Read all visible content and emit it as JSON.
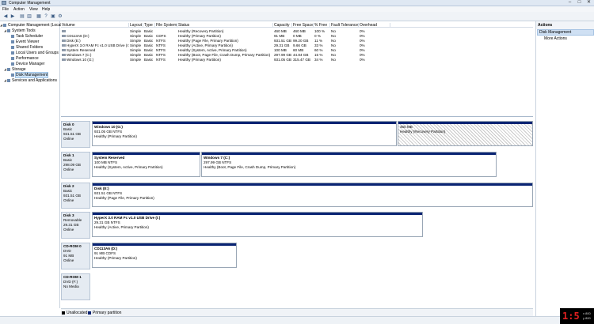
{
  "title": "Computer Management",
  "menu": [
    "File",
    "Action",
    "View",
    "Help"
  ],
  "tree": [
    {
      "label": "Computer Management (Local)",
      "indent": 0
    },
    {
      "label": "System Tools",
      "indent": 1
    },
    {
      "label": "Task Scheduler",
      "indent": 2
    },
    {
      "label": "Event Viewer",
      "indent": 2
    },
    {
      "label": "Shared Folders",
      "indent": 2
    },
    {
      "label": "Local Users and Groups",
      "indent": 2
    },
    {
      "label": "Performance",
      "indent": 2
    },
    {
      "label": "Device Manager",
      "indent": 2
    },
    {
      "label": "Storage",
      "indent": 1
    },
    {
      "label": "Disk Management",
      "indent": 2,
      "selected": true
    },
    {
      "label": "Services and Applications",
      "indent": 1
    }
  ],
  "columns": [
    "Volume",
    "Layout",
    "Type",
    "File System",
    "Status",
    "Capacity",
    "Free Space",
    "% Free",
    "Fault Tolerance",
    "Overhead"
  ],
  "volumes": [
    [
      "",
      "Simple",
      "Basic",
      "",
      "Healthy (Recovery Partition)",
      "460 MB",
      "460 MB",
      "100 %",
      "No",
      "0%"
    ],
    [
      "CD113A6 (D:)",
      "Simple",
      "Basic",
      "CDFS",
      "Healthy (Primary Partition)",
      "91 MB",
      "0 MB",
      "0 %",
      "No",
      "0%"
    ],
    [
      "Disk (E:)",
      "Simple",
      "Basic",
      "NTFS",
      "Healthy (Page File, Primary Partition)",
      "931.51 GB",
      "99.20 GB",
      "11 %",
      "No",
      "0%"
    ],
    [
      "HyperX 3.0 RAM Fc v1.0 USB Drive (I:)",
      "Simple",
      "Basic",
      "NTFS",
      "Healthy (Active, Primary Partition)",
      "29.31 GB",
      "9.66 GB",
      "33 %",
      "No",
      "0%"
    ],
    [
      "System Reserved",
      "Simple",
      "Basic",
      "NTFS",
      "Healthy (System, Active, Primary Partition)",
      "100 MB",
      "60 MB",
      "60 %",
      "No",
      "0%"
    ],
    [
      "Windows 7 (C:)",
      "Simple",
      "Basic",
      "NTFS",
      "Healthy (Boot, Page File, Crash Dump, Primary Partition)",
      "297.99 GB",
      "44.84 GB",
      "15 %",
      "No",
      "0%"
    ],
    [
      "Windows 10 (G:)",
      "Simple",
      "Basic",
      "NTFS",
      "Healthy (Primary Partition)",
      "931.05 GB",
      "315.47 GB",
      "34 %",
      "No",
      "0%"
    ]
  ],
  "disks": [
    {
      "name": "Disk 0",
      "type": "Basic",
      "size": "931.51 GB",
      "state": "Online",
      "parts": [
        {
          "name": "Windows 10  (G:)",
          "size": "931.05 GB NTFS",
          "status": "Healthy (Primary Partition)"
        },
        {
          "name": "",
          "size": "460 MB",
          "status": "Healthy (Recovery Partition)"
        }
      ]
    },
    {
      "name": "Disk 1",
      "type": "Basic",
      "size": "298.09 GB",
      "state": "Online",
      "parts": [
        {
          "name": "System Reserved",
          "size": "100 MB NTFS",
          "status": "Healthy (System, Active, Primary Partition)"
        },
        {
          "name": "Windows 7  (C:)",
          "size": "297.99 GB NTFS",
          "status": "Healthy (Boot, Page File, Crash Dump, Primary Partition)"
        }
      ]
    },
    {
      "name": "Disk 2",
      "type": "Basic",
      "size": "931.51 GB",
      "state": "Online",
      "parts": [
        {
          "name": "Disk  (E:)",
          "size": "931.51 GB NTFS",
          "status": "Healthy (Page File, Primary Partition)"
        }
      ]
    },
    {
      "name": "Disk 3",
      "type": "Removable",
      "size": "29.31 GB",
      "state": "Online",
      "parts": [
        {
          "name": "HyperX 3.0 RAM Fc v1.0 USB Drive  (I:)",
          "size": "29.31 GB NTFS",
          "status": "Healthy (Active, Primary Partition)"
        }
      ]
    },
    {
      "name": "CD-ROM 0",
      "type": "DVD",
      "size": "91 MB",
      "state": "Online",
      "parts": [
        {
          "name": "CD113A6  (D:)",
          "size": "91 MB CDFS",
          "status": "Healthy (Primary Partition)"
        }
      ]
    },
    {
      "name": "CD-ROM 1",
      "type": "DVD (F:)",
      "size": "",
      "state": "No Media",
      "parts": []
    }
  ],
  "legend": {
    "unallocated": "Unallocated",
    "primary": "Primary partition",
    "unalloc_color": "#000000",
    "primary_color": "#0a2473"
  },
  "actions": {
    "header": "Actions",
    "group": "Disk Management",
    "item": "More Actions"
  },
  "tray": {
    "clock": "1:5",
    "counter_top": "x 800",
    "counter_bot": "y 800"
  }
}
